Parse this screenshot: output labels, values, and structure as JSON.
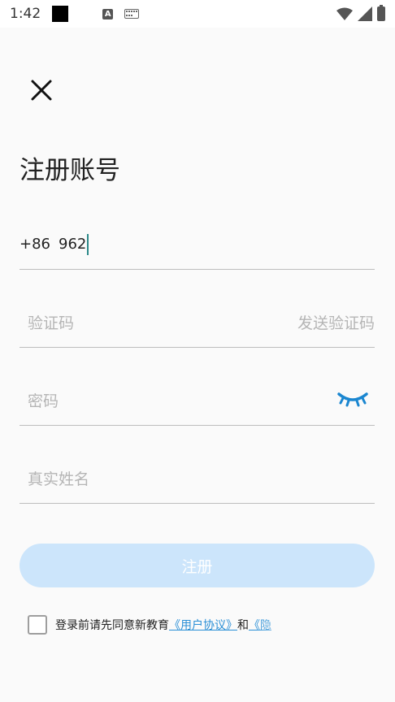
{
  "status_bar": {
    "time": "1:42",
    "a_label": "A"
  },
  "page": {
    "title": "注册账号"
  },
  "form": {
    "phone": {
      "country_code": "+86",
      "value": "962"
    },
    "code": {
      "placeholder": "验证码",
      "send_label": "发送验证码"
    },
    "password": {
      "placeholder": "密码"
    },
    "real_name": {
      "placeholder": "真实姓名"
    },
    "submit_label": "注册"
  },
  "agreement": {
    "prefix": "登录前请先同意新教育",
    "user_agreement": "《用户协议》",
    "and": "和",
    "privacy_partial": "《隐"
  },
  "colors": {
    "accent": "#2a8fd6",
    "button_disabled": "#cce5fb",
    "cursor": "#2c8a8a"
  }
}
